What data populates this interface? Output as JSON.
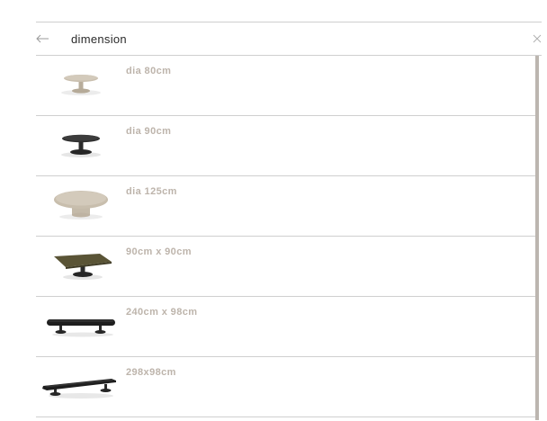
{
  "header": {
    "title": "dimension",
    "back_icon": "arrow-left-icon",
    "close_icon": "close-icon"
  },
  "items": [
    {
      "label": "dia 80cm",
      "image": "small-round-table-beige"
    },
    {
      "label": "dia 90cm",
      "image": "round-table-black"
    },
    {
      "label": "dia 125cm",
      "image": "large-round-table-beige"
    },
    {
      "label": "90cm x 90cm",
      "image": "square-table-olive"
    },
    {
      "label": "240cm x 98cm",
      "image": "long-oval-table-black"
    },
    {
      "label": "298x98cm",
      "image": "long-oval-table-black-angled"
    }
  ],
  "colors": {
    "label": "#bdb4ab",
    "divider": "#cfcfcf",
    "scrollbar": "#bcb6b0",
    "beige": "#c9bfaf",
    "dark": "#2d2d2d",
    "olive": "#5a5436"
  }
}
